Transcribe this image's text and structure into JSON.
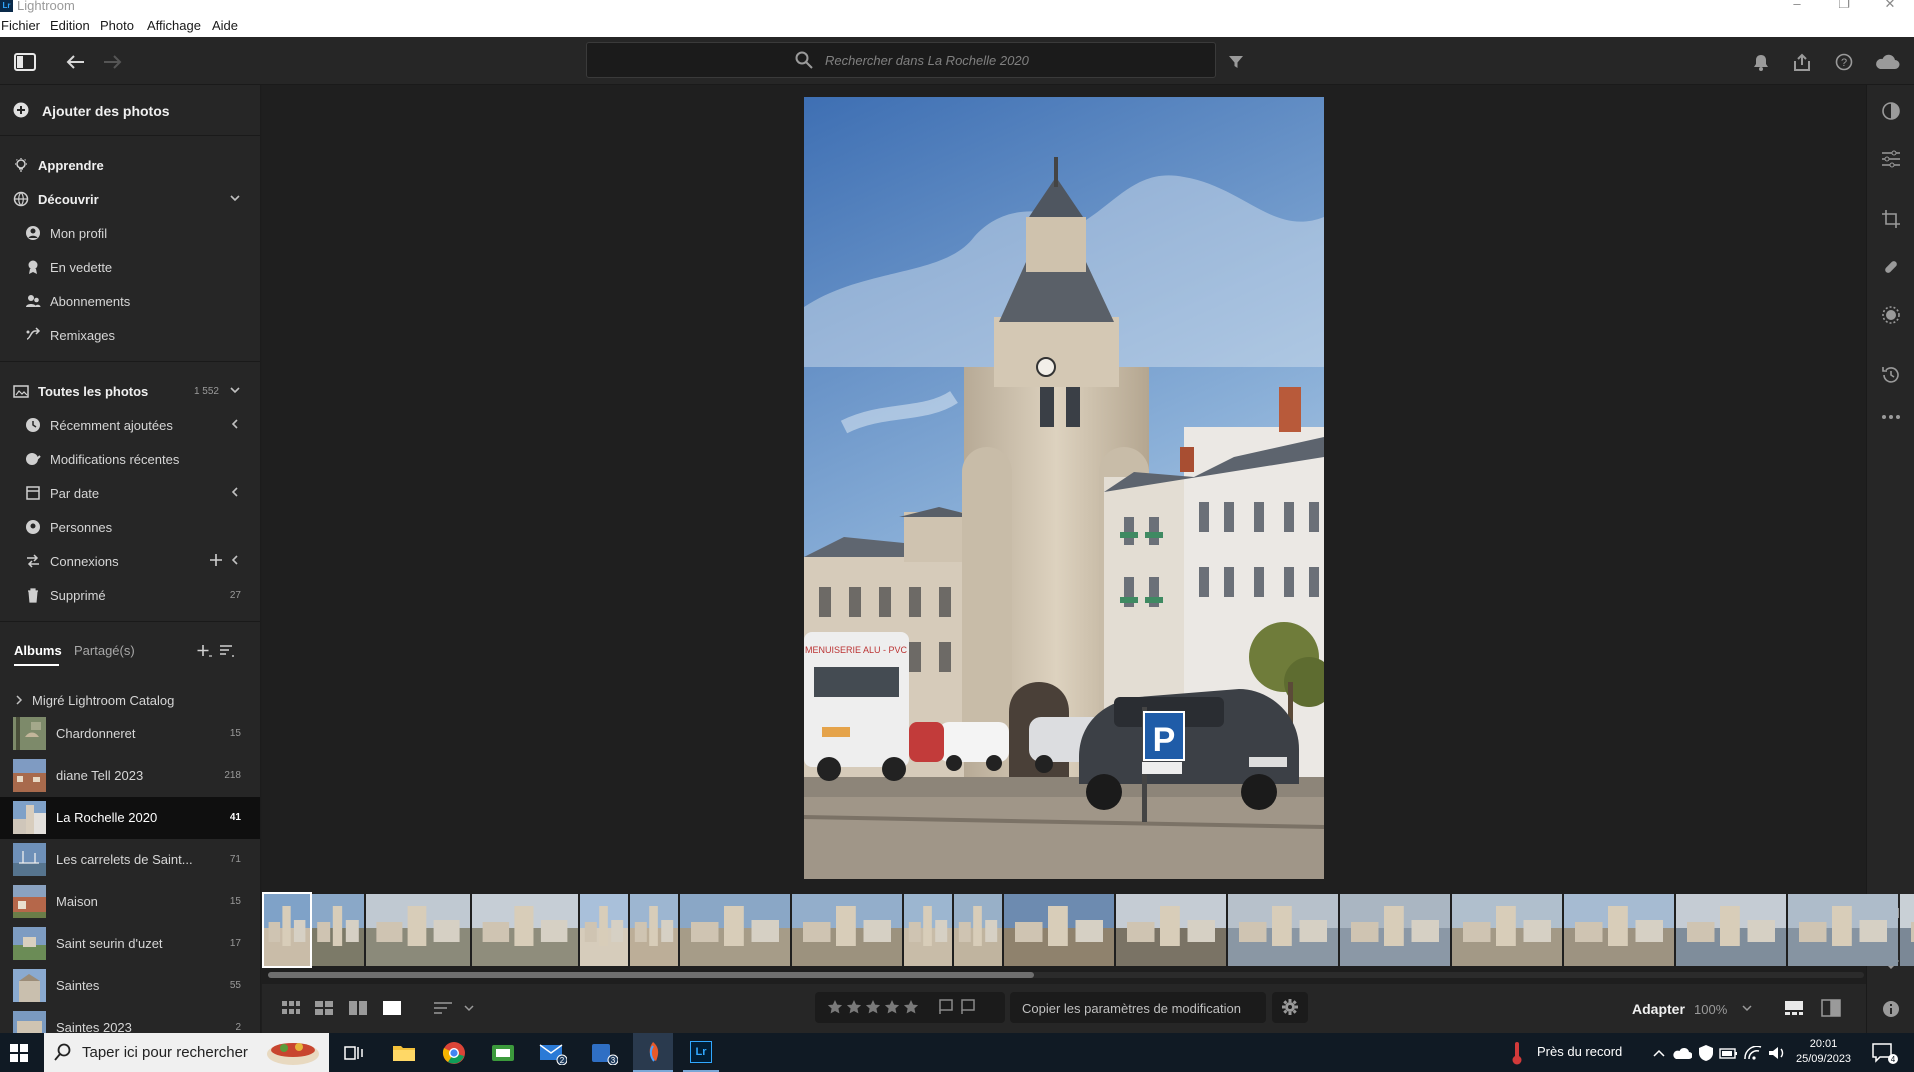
{
  "window": {
    "app_logo": "Lr",
    "title": "Lightroom",
    "controls": [
      "–",
      "❐",
      "✕"
    ]
  },
  "menu": [
    "Fichier",
    "Edition",
    "Photo",
    "Affichage",
    "Aide"
  ],
  "toolbar": {
    "search_placeholder": "Rechercher dans La Rochelle 2020",
    "icons": [
      "panel-toggle-icon",
      "back-arrow-icon",
      "forward-arrow-icon",
      "search-icon",
      "filter-icon",
      "bell-icon",
      "share-icon",
      "help-icon",
      "cloud-icon"
    ]
  },
  "sidebar": {
    "add_photos": "Ajouter des photos",
    "learn": "Apprendre",
    "discover": {
      "label": "Découvrir",
      "items": [
        "Mon profil",
        "En vedette",
        "Abonnements",
        "Remixages"
      ]
    },
    "all_photos": {
      "label": "Toutes les photos",
      "count": "1 552"
    },
    "library": [
      {
        "label": "Récemment ajoutées",
        "count": ""
      },
      {
        "label": "Modifications récentes",
        "count": ""
      },
      {
        "label": "Par date",
        "count": ""
      },
      {
        "label": "Personnes",
        "count": ""
      },
      {
        "label": "Connexions",
        "count": ""
      },
      {
        "label": "Supprimé",
        "count": "27"
      }
    ],
    "tabs": {
      "albums": "Albums",
      "shared": "Partagé(s)"
    },
    "catalog_group": "Migré Lightroom Catalog",
    "albums": [
      {
        "name": "Chardonneret",
        "count": "15",
        "selected": false
      },
      {
        "name": "diane Tell 2023",
        "count": "218",
        "selected": false
      },
      {
        "name": "La Rochelle 2020",
        "count": "41",
        "selected": true
      },
      {
        "name": "Les carrelets de Saint...",
        "count": "71",
        "selected": false
      },
      {
        "name": "Maison",
        "count": "15",
        "selected": false
      },
      {
        "name": "Saint seurin d'uzet",
        "count": "17",
        "selected": false
      },
      {
        "name": "Saintes",
        "count": "55",
        "selected": false
      },
      {
        "name": "Saintes 2023",
        "count": "2",
        "selected": false
      }
    ]
  },
  "main_photo": {
    "sign_text": "MENUISERIE ALU - PVC",
    "parking_sign": "P"
  },
  "filmstrip": {
    "thumbnail_count": 20,
    "scroll_fraction": 0.48
  },
  "bottombar": {
    "copy_settings": "Copier les paramètres de modification",
    "fit": "Adapter",
    "zoom": "100%",
    "stars": 5
  },
  "taskbar": {
    "search": "Taper ici pour rechercher",
    "weather": "Près du record",
    "time": "20:01",
    "date": "25/09/2023",
    "mail_badge": "2",
    "teams_badge": "3",
    "notif_badge": "4",
    "lr_label": "Lr"
  },
  "colors": {
    "panel": "#262626",
    "background": "#1e1e1e",
    "selected_row": "#0f0f0f",
    "accent": "#31a8ff",
    "taskbar": "#101a24"
  }
}
